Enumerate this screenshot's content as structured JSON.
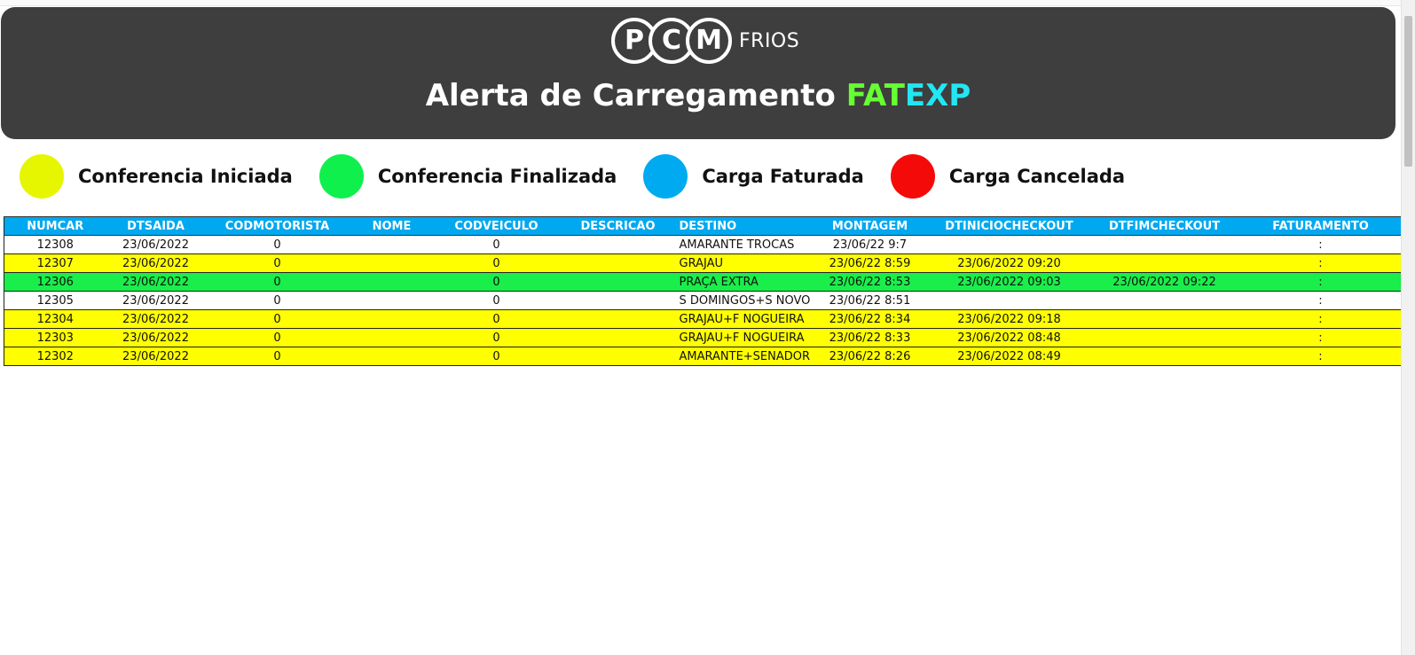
{
  "header": {
    "logo_letters": [
      "P",
      "C",
      "M"
    ],
    "logo_suffix": "FRIOS",
    "title_main": "Alerta de Carregamento",
    "title_fat": "FAT",
    "title_exp": "EXP",
    "colors": {
      "background": "#3e3e3e",
      "fat": "#66ff33",
      "exp": "#22e6f2"
    }
  },
  "legend": [
    {
      "label": "Conferencia Iniciada",
      "color": "#e6f500"
    },
    {
      "label": "Conferencia Finalizada",
      "color": "#0ff04d"
    },
    {
      "label": "Carga Faturada",
      "color": "#00aaf0"
    },
    {
      "label": "Carga Cancelada",
      "color": "#f50a0a"
    }
  ],
  "table": {
    "header_color": "#00a8f0",
    "columns": [
      "NUMCAR",
      "DTSAIDA",
      "CODMOTORISTA",
      "NOME",
      "CODVEICULO",
      "DESCRICAO",
      "DESTINO",
      "MONTAGEM",
      "DTINICIOCHECKOUT",
      "DTFIMCHECKOUT",
      "FATURAMENTO"
    ],
    "rows": [
      {
        "status_color": "#ffffff",
        "cells": [
          "12308",
          "23/06/2022",
          "0",
          "",
          "0",
          "",
          "AMARANTE TROCAS",
          "23/06/22 9:7",
          "",
          "",
          ":"
        ]
      },
      {
        "status_color": "#ffff00",
        "cells": [
          "12307",
          "23/06/2022",
          "0",
          "",
          "0",
          "",
          "GRAJAU",
          "23/06/22 8:59",
          "23/06/2022 09:20",
          "",
          ":"
        ]
      },
      {
        "status_color": "#1aee4a",
        "cells": [
          "12306",
          "23/06/2022",
          "0",
          "",
          "0",
          "",
          "PRAÇA EXTRA",
          "23/06/22 8:53",
          "23/06/2022 09:03",
          "23/06/2022 09:22",
          ":"
        ]
      },
      {
        "status_color": "#ffffff",
        "cells": [
          "12305",
          "23/06/2022",
          "0",
          "",
          "0",
          "",
          "S DOMINGOS+S NOVO",
          "23/06/22 8:51",
          "",
          "",
          ":"
        ]
      },
      {
        "status_color": "#ffff00",
        "cells": [
          "12304",
          "23/06/2022",
          "0",
          "",
          "0",
          "",
          "GRAJAU+F NOGUEIRA",
          "23/06/22 8:34",
          "23/06/2022 09:18",
          "",
          ":"
        ]
      },
      {
        "status_color": "#ffff00",
        "cells": [
          "12303",
          "23/06/2022",
          "0",
          "",
          "0",
          "",
          "GRAJAU+F NOGUEIRA",
          "23/06/22 8:33",
          "23/06/2022 08:48",
          "",
          ":"
        ]
      },
      {
        "status_color": "#ffff00",
        "cells": [
          "12302",
          "23/06/2022",
          "0",
          "",
          "0",
          "",
          "AMARANTE+SENADOR",
          "23/06/22 8:26",
          "23/06/2022 08:49",
          "",
          ":"
        ]
      }
    ]
  }
}
